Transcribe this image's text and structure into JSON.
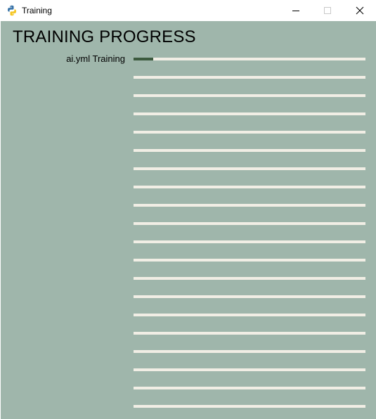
{
  "window": {
    "title": "Training",
    "icon": "python-icon"
  },
  "page": {
    "heading": "TRAINING PROGRESS"
  },
  "rows": [
    {
      "label": "ai.yml Training",
      "progress": 0.085
    },
    {
      "label": "",
      "progress": 0
    },
    {
      "label": "",
      "progress": 0
    },
    {
      "label": "",
      "progress": 0
    },
    {
      "label": "",
      "progress": 0
    },
    {
      "label": "",
      "progress": 0
    },
    {
      "label": "",
      "progress": 0
    },
    {
      "label": "",
      "progress": 0
    },
    {
      "label": "",
      "progress": 0
    },
    {
      "label": "",
      "progress": 0
    },
    {
      "label": "",
      "progress": 0
    },
    {
      "label": "",
      "progress": 0
    },
    {
      "label": "",
      "progress": 0
    },
    {
      "label": "",
      "progress": 0
    },
    {
      "label": "",
      "progress": 0
    },
    {
      "label": "",
      "progress": 0
    },
    {
      "label": "",
      "progress": 0
    },
    {
      "label": "",
      "progress": 0
    },
    {
      "label": "",
      "progress": 0
    },
    {
      "label": "",
      "progress": 0
    }
  ],
  "colors": {
    "background": "#9fb6ab",
    "track": "#f1eee5",
    "fill": "#3c5a3e"
  }
}
